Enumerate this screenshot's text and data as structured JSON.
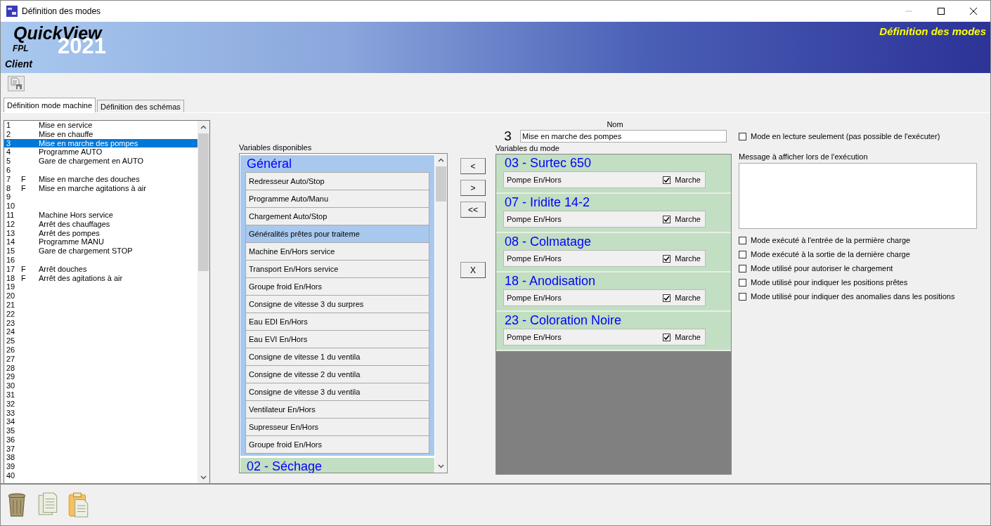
{
  "window": {
    "title": "Définition des modes"
  },
  "banner": {
    "product": "QuickView",
    "company": "FPL",
    "year": "2021",
    "edition": "Client",
    "page_title": "Définition des modes"
  },
  "tabs": [
    {
      "label": "Définition mode machine",
      "selected": true
    },
    {
      "label": "Définition des schémas",
      "selected": false
    }
  ],
  "modes": [
    {
      "number": "1",
      "name": "Mise en service",
      "selected": false
    },
    {
      "number": "2",
      "name": "Mise en chauffe",
      "selected": false
    },
    {
      "number": "3",
      "name": "Mise en marche des pompes",
      "selected": true
    },
    {
      "number": "4",
      "name": "Programme AUTO",
      "selected": false
    },
    {
      "number": "5",
      "name": "Gare de chargement en AUTO",
      "selected": false
    },
    {
      "number": "6",
      "selected": false
    },
    {
      "number": "7",
      "flag": "F",
      "name": "Mise en marche des douches",
      "selected": false
    },
    {
      "number": "8",
      "flag": "F",
      "name": "Mise en marche agitations à air",
      "selected": false
    },
    {
      "number": "9",
      "selected": false
    },
    {
      "number": "10",
      "selected": false
    },
    {
      "number": "11",
      "name": "Machine Hors service",
      "selected": false
    },
    {
      "number": "12",
      "name": "Arrêt des chauffages",
      "selected": false
    },
    {
      "number": "13",
      "name": "Arrêt des pompes",
      "selected": false
    },
    {
      "number": "14",
      "name": "Programme MANU",
      "selected": false
    },
    {
      "number": "15",
      "name": "Gare de chargement STOP",
      "selected": false
    },
    {
      "number": "16",
      "selected": false
    },
    {
      "number": "17",
      "flag": "F",
      "name": "Arrêt douches",
      "selected": false
    },
    {
      "number": "18",
      "flag": "F",
      "name": "Arrêt des agitations à air",
      "selected": false
    },
    {
      "number": "19",
      "selected": false
    },
    {
      "number": "20",
      "selected": false
    },
    {
      "number": "21",
      "selected": false
    },
    {
      "number": "22",
      "selected": false
    },
    {
      "number": "23",
      "selected": false
    },
    {
      "number": "24",
      "selected": false
    },
    {
      "number": "25",
      "selected": false
    },
    {
      "number": "26",
      "selected": false
    },
    {
      "number": "27",
      "selected": false
    },
    {
      "number": "28",
      "selected": false
    },
    {
      "number": "29",
      "selected": false
    },
    {
      "number": "30",
      "selected": false
    },
    {
      "number": "31",
      "selected": false
    },
    {
      "number": "32",
      "selected": false
    },
    {
      "number": "33",
      "selected": false
    },
    {
      "number": "34",
      "selected": false
    },
    {
      "number": "35",
      "selected": false
    },
    {
      "number": "36",
      "selected": false
    },
    {
      "number": "37",
      "selected": false
    },
    {
      "number": "38",
      "selected": false
    },
    {
      "number": "39",
      "selected": false
    },
    {
      "number": "40",
      "selected": false
    }
  ],
  "available": {
    "label": "Variables disponibles",
    "groups": [
      {
        "title": "Général",
        "color": "#a8c8ee",
        "items": [
          {
            "label": "Redresseur Auto/Stop",
            "selected": false
          },
          {
            "label": "Programme Auto/Manu",
            "selected": false
          },
          {
            "label": "Chargement Auto/Stop",
            "selected": false
          },
          {
            "label": "Généralités prêtes pour traiteme",
            "selected": true
          },
          {
            "label": "Machine En/Hors service",
            "selected": false
          },
          {
            "label": "Transport En/Hors service",
            "selected": false
          },
          {
            "label": "Groupe froid En/Hors",
            "selected": false
          },
          {
            "label": "Consigne de vitesse 3 du surpres",
            "selected": false
          },
          {
            "label": "Eau EDI En/Hors",
            "selected": false
          },
          {
            "label": "Eau EVI En/Hors",
            "selected": false
          },
          {
            "label": "Consigne de vitesse 1 du ventila",
            "selected": false
          },
          {
            "label": "Consigne de vitesse 2 du ventila",
            "selected": false
          },
          {
            "label": "Consigne de vitesse 3 du ventila",
            "selected": false
          },
          {
            "label": "Ventilateur En/Hors",
            "selected": false
          },
          {
            "label": "Supresseur En/Hors",
            "selected": false
          },
          {
            "label": "Groupe froid En/Hors",
            "selected": false
          }
        ]
      },
      {
        "title": "02 - Séchage",
        "color": "#c2dec3"
      }
    ]
  },
  "transfer_buttons": [
    "<",
    ">",
    "<<"
  ],
  "remove_button": "X",
  "name_field": {
    "label": "Nom",
    "number": "3",
    "value": "Mise en marche des pompes"
  },
  "mode_variables": {
    "label": "Variables du mode",
    "groups": [
      {
        "title": "03 - Surtec 650",
        "items": [
          {
            "label": "Pompe En/Hors",
            "checked": true,
            "option": "Marche"
          }
        ]
      },
      {
        "title": "07 - Iridite 14-2",
        "items": [
          {
            "label": "Pompe En/Hors",
            "checked": true,
            "option": "Marche"
          }
        ]
      },
      {
        "title": "08 - Colmatage",
        "items": [
          {
            "label": "Pompe En/Hors",
            "checked": true,
            "option": "Marche"
          }
        ]
      },
      {
        "title": "18 - Anodisation",
        "items": [
          {
            "label": "Pompe En/Hors",
            "checked": true,
            "option": "Marche"
          }
        ]
      },
      {
        "title": "23 - Coloration Noire",
        "items": [
          {
            "label": "Pompe En/Hors",
            "checked": true,
            "option": "Marche"
          }
        ]
      }
    ]
  },
  "read_only": {
    "label": "Mode en lecture seulement (pas possible de l'exécuter)",
    "checked": false
  },
  "message": {
    "label": "Message à afficher lors de l'exécution"
  },
  "options": [
    {
      "label": "Mode exécuté à l'entrée de la permière charge",
      "checked": false
    },
    {
      "label": "Mode exécuté à la sortie de la dernière charge",
      "checked": false
    },
    {
      "label": "Mode utilisé pour autoriser le chargement",
      "checked": false
    },
    {
      "label": "Mode utilisé pour indiquer les positions prêtes",
      "checked": false
    },
    {
      "label": "Mode utilisé pour indiquer des anomalies dans les positions",
      "checked": false
    }
  ]
}
